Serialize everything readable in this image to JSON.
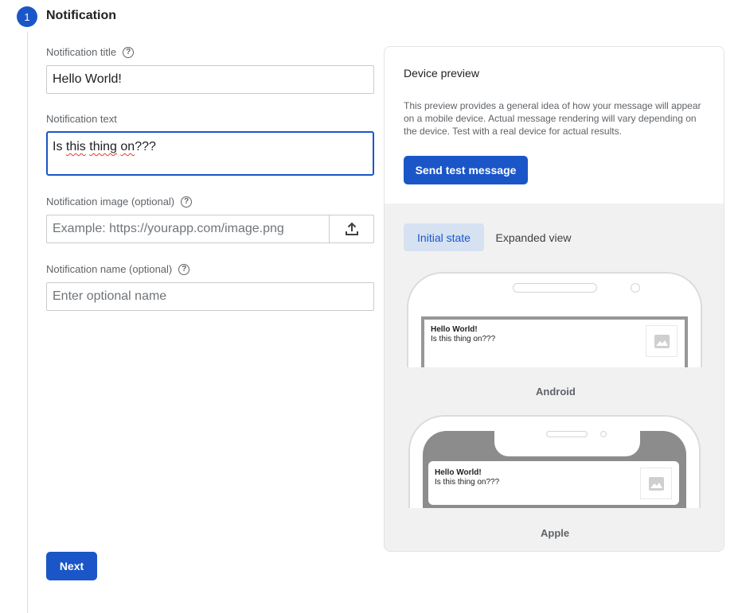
{
  "step": {
    "number": "1",
    "title": "Notification"
  },
  "form": {
    "title_label": "Notification title",
    "title_value": "Hello World!",
    "text_label": "Notification text",
    "text_value_parts": [
      "Is ",
      "this",
      " ",
      "thing",
      " ",
      "on",
      "???"
    ],
    "image_label": "Notification image (optional)",
    "image_placeholder": "Example: https://yourapp.com/image.png",
    "name_label": "Notification name (optional)",
    "name_placeholder": "Enter optional name",
    "help_glyph": "?",
    "next_label": "Next"
  },
  "preview": {
    "title": "Device preview",
    "description": "This preview provides a general idea of how your message will appear on a mobile device. Actual message rendering will vary depending on the device. Test with a real device for actual results.",
    "send_test_label": "Send test message",
    "tabs": [
      {
        "label": "Initial state",
        "active": true
      },
      {
        "label": "Expanded view",
        "active": false
      }
    ],
    "android": {
      "notif_title": "Hello World!",
      "notif_text": "Is this thing on???",
      "label": "Android"
    },
    "apple": {
      "notif_title": "Hello World!",
      "notif_text": "Is this thing on???",
      "label": "Apple"
    }
  },
  "icons": {
    "step": "step-number-badge",
    "help": "help-circle-icon",
    "upload": "upload-icon",
    "image_placeholder": "image-placeholder-icon"
  },
  "colors": {
    "primary": "#1a56c8",
    "tab_active_bg": "#d6e2f2",
    "panel_bg": "#f1f1f1",
    "spellcheck": "#e53935"
  }
}
